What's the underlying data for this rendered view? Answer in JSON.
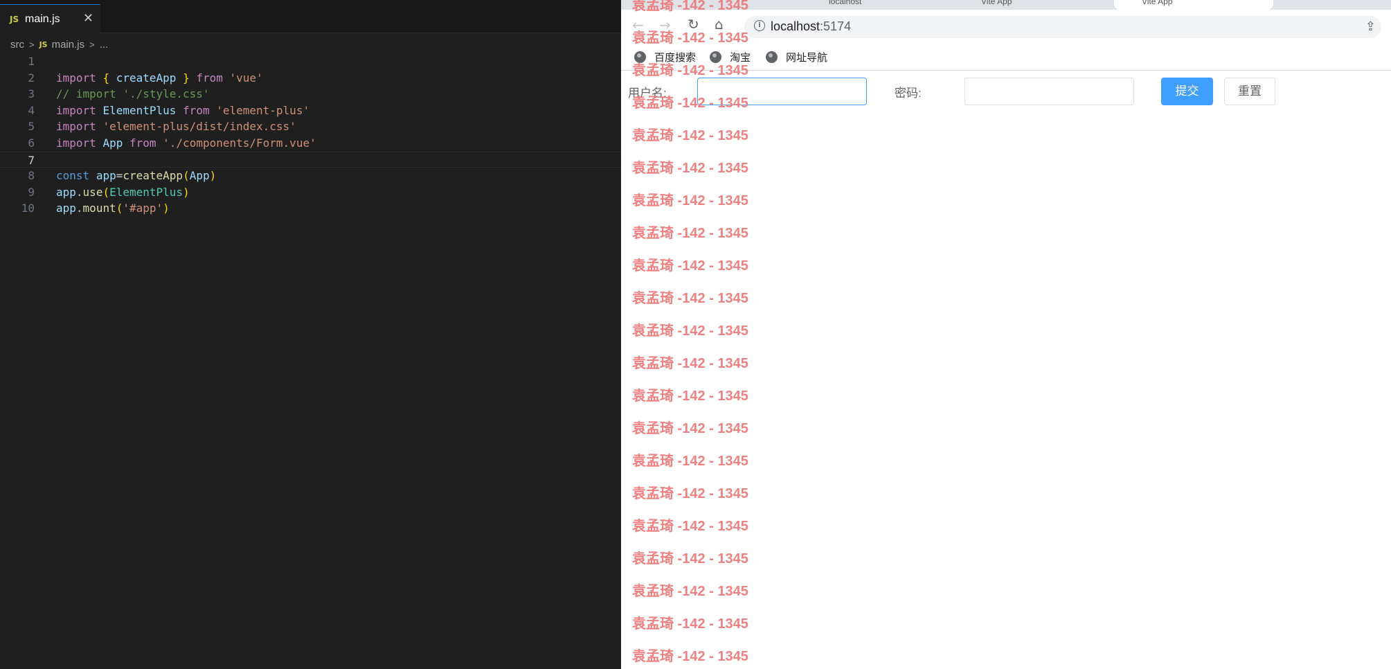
{
  "editor": {
    "tab": {
      "icon": "js-file-icon",
      "label": "main.js",
      "close": "✕"
    },
    "breadcrumb": {
      "folder": "src",
      "file": "main.js",
      "more": "..."
    },
    "lines": [
      {
        "n": "1",
        "tokens": []
      },
      {
        "n": "2",
        "tokens": [
          [
            "kw",
            "import"
          ],
          [
            "pl",
            " "
          ],
          [
            "br",
            "{"
          ],
          [
            "pl",
            " "
          ],
          [
            "id",
            "createApp"
          ],
          [
            "pl",
            " "
          ],
          [
            "br",
            "}"
          ],
          [
            "pl",
            " "
          ],
          [
            "kw",
            "from"
          ],
          [
            "pl",
            " "
          ],
          [
            "str",
            "'vue'"
          ]
        ]
      },
      {
        "n": "3",
        "tokens": [
          [
            "cm",
            "// import './style.css'"
          ]
        ]
      },
      {
        "n": "4",
        "tokens": [
          [
            "kw",
            "import"
          ],
          [
            "pl",
            " "
          ],
          [
            "id",
            "ElementPlus"
          ],
          [
            "pl",
            " "
          ],
          [
            "kw",
            "from"
          ],
          [
            "pl",
            " "
          ],
          [
            "str",
            "'element-plus'"
          ]
        ]
      },
      {
        "n": "5",
        "tokens": [
          [
            "kw",
            "import"
          ],
          [
            "pl",
            " "
          ],
          [
            "str",
            "'element-plus/dist/index.css'"
          ]
        ]
      },
      {
        "n": "6",
        "tokens": [
          [
            "kw",
            "import"
          ],
          [
            "pl",
            " "
          ],
          [
            "id",
            "App"
          ],
          [
            "pl",
            " "
          ],
          [
            "kw",
            "from"
          ],
          [
            "pl",
            " "
          ],
          [
            "str",
            "'./components/Form.vue'"
          ]
        ]
      },
      {
        "n": "7",
        "tokens": []
      },
      {
        "n": "8",
        "tokens": [
          [
            "kw2",
            "const"
          ],
          [
            "pl",
            " "
          ],
          [
            "id",
            "app"
          ],
          [
            "pl",
            "="
          ],
          [
            "fn",
            "createApp"
          ],
          [
            "br",
            "("
          ],
          [
            "id",
            "App"
          ],
          [
            "br",
            ")"
          ]
        ]
      },
      {
        "n": "9",
        "tokens": [
          [
            "id",
            "app"
          ],
          [
            "pl",
            "."
          ],
          [
            "fn",
            "use"
          ],
          [
            "br",
            "("
          ],
          [
            "cls",
            "ElementPlus"
          ],
          [
            "br",
            ")"
          ]
        ]
      },
      {
        "n": "10",
        "tokens": [
          [
            "id",
            "app"
          ],
          [
            "pl",
            "."
          ],
          [
            "fn",
            "mount"
          ],
          [
            "br",
            "("
          ],
          [
            "str",
            "'#app'"
          ],
          [
            "br",
            ")"
          ]
        ]
      }
    ],
    "current_line": "7"
  },
  "browser": {
    "tabs": [
      "localhost",
      "Vite App",
      "Vite App"
    ],
    "url_host": "localhost",
    "url_port": ":5174",
    "bookmarks": [
      "百度搜索",
      "淘宝",
      "网址导航"
    ],
    "form": {
      "username_label": "用户名:",
      "password_label": "密码:",
      "submit_label": "提交",
      "reset_label": "重置",
      "username_value": "",
      "password_value": ""
    },
    "watermark_text": "袁孟琦 -142 - 1345"
  }
}
